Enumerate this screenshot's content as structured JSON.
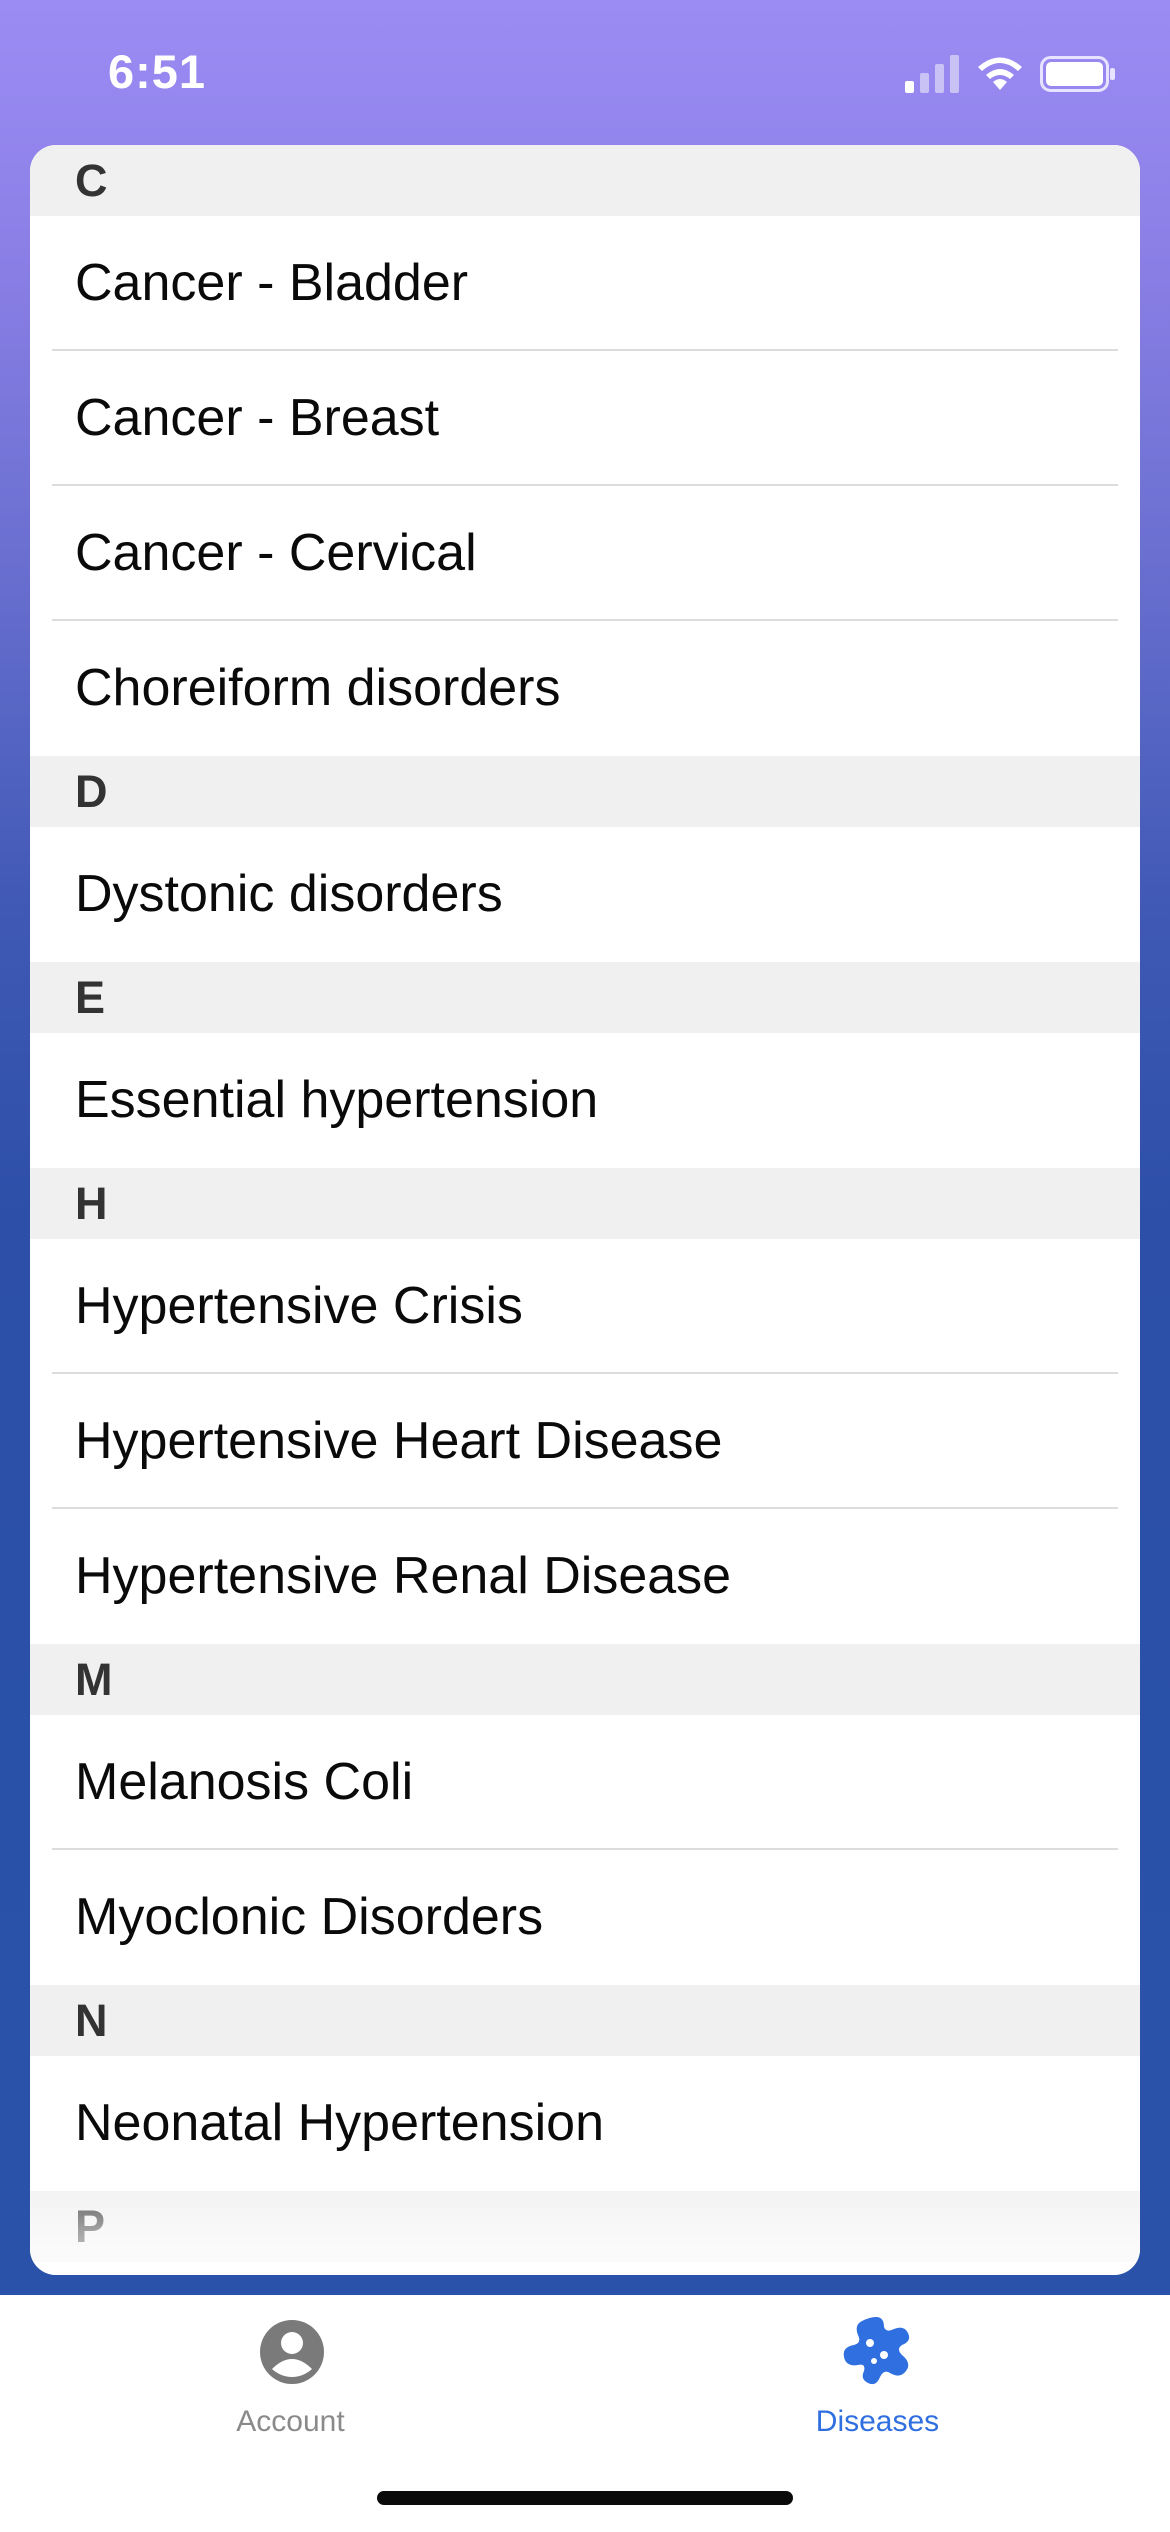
{
  "status_bar": {
    "time": "6:51",
    "icons": [
      "cellular-signal-icon",
      "wifi-icon",
      "battery-icon"
    ]
  },
  "list": {
    "sections": [
      {
        "letter": "C",
        "items": [
          "Cancer - Bladder",
          "Cancer - Breast",
          "Cancer - Cervical",
          "Choreiform disorders"
        ]
      },
      {
        "letter": "D",
        "items": [
          "Dystonic disorders"
        ]
      },
      {
        "letter": "E",
        "items": [
          "Essential hypertension"
        ]
      },
      {
        "letter": "H",
        "items": [
          "Hypertensive Crisis",
          "Hypertensive Heart Disease",
          "Hypertensive Renal Disease"
        ]
      },
      {
        "letter": "M",
        "items": [
          "Melanosis Coli",
          "Myoclonic Disorders"
        ]
      },
      {
        "letter": "N",
        "items": [
          "Neonatal Hypertension"
        ]
      },
      {
        "letter": "P",
        "items": []
      }
    ]
  },
  "tab_bar": {
    "tabs": [
      {
        "label": "Account",
        "icon": "account-circle-icon",
        "active": false
      },
      {
        "label": "Diseases",
        "icon": "virus-icon",
        "active": true
      }
    ],
    "active_color": "#2f6fe0",
    "inactive_color": "#8a8a8a"
  }
}
